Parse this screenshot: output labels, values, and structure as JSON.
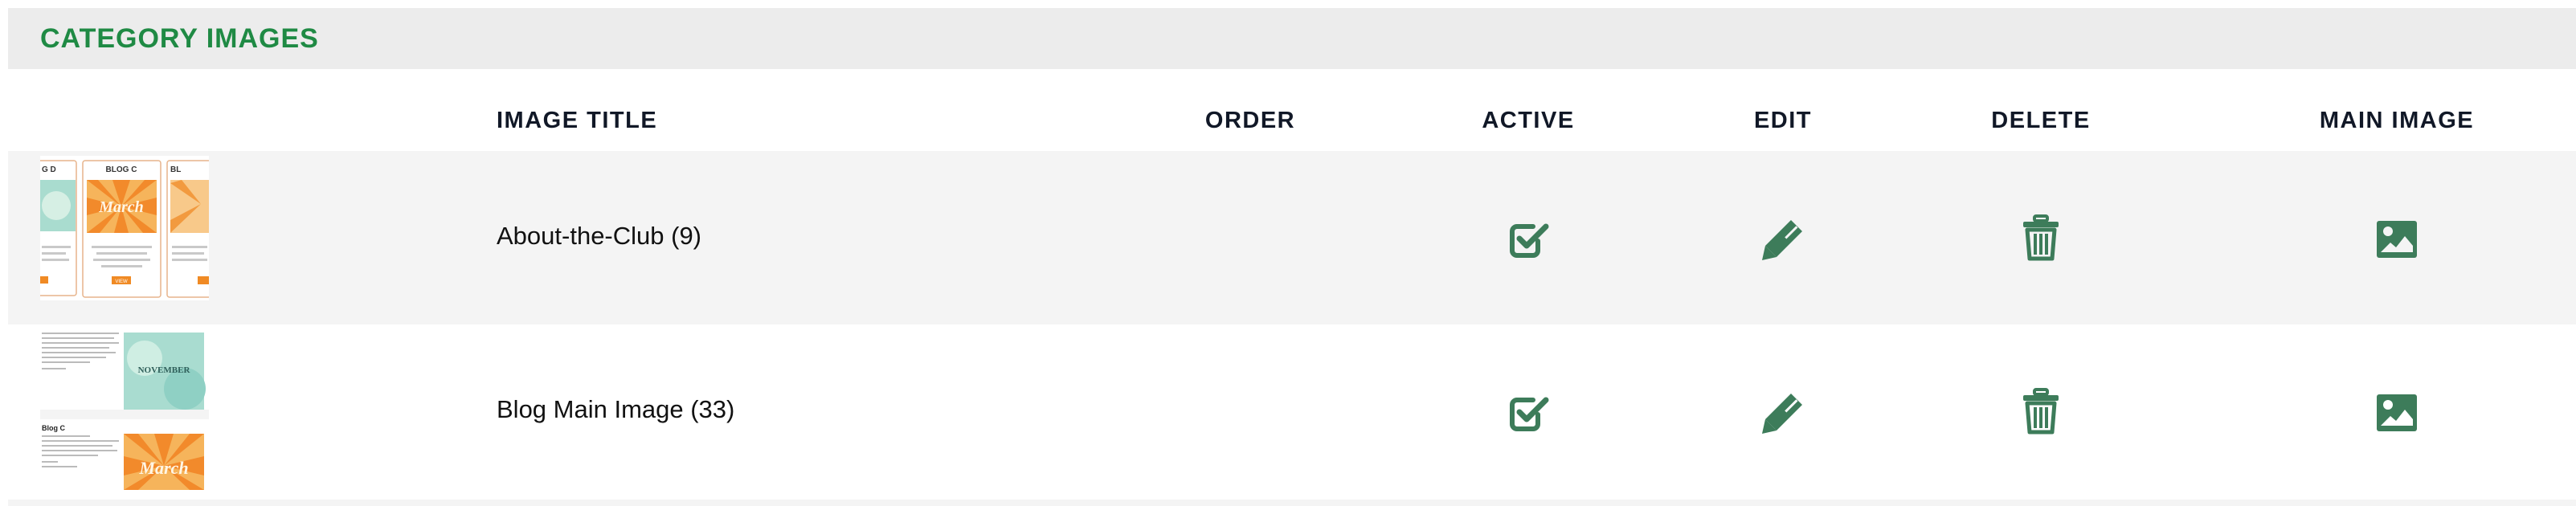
{
  "section": {
    "title": "CATEGORY IMAGES"
  },
  "table": {
    "headers": {
      "image_title": "IMAGE TITLE",
      "order": "ORDER",
      "active": "ACTIVE",
      "edit": "EDIT",
      "delete": "DELETE",
      "main_image": "MAIN IMAGE"
    },
    "rows": [
      {
        "title": "About-the-Club (9)",
        "thumbnail": {
          "card_labels": [
            "G D",
            "BLOG C",
            "BL"
          ],
          "art_text": "March",
          "button_label": "VIEW"
        }
      },
      {
        "title": "Blog Main Image (33)",
        "thumbnail": {
          "heading": "Blog C",
          "art_text_1": "NOVEMBER",
          "art_text_2": "March"
        }
      }
    ]
  },
  "icons": {
    "active": "checkbox-checked-icon",
    "edit": "pencil-icon",
    "delete": "trash-icon",
    "main_image": "image-icon"
  },
  "colors": {
    "heading_green": "#1f8a44",
    "icon_green": "#3d7c5a",
    "header_bar": "#ececec",
    "row_alt": "#f4f4f4"
  }
}
